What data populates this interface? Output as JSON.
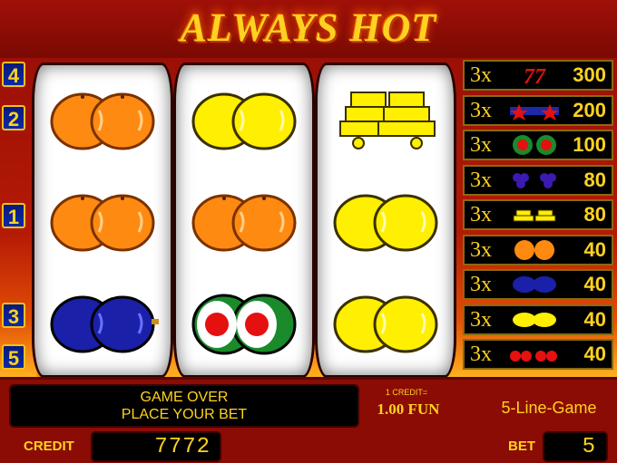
{
  "game": {
    "title": "ALWAYS HOT"
  },
  "reels": [
    [
      "orange",
      "orange",
      "plum"
    ],
    [
      "lemon",
      "orange",
      "melon"
    ],
    [
      "bar",
      "lemon",
      "lemon"
    ]
  ],
  "line_markers": {
    "left": [
      "4",
      "2",
      "1",
      "3",
      "5"
    ]
  },
  "paytable": [
    {
      "multiplier": "3x",
      "symbol": "seven",
      "label": "77",
      "value": "300"
    },
    {
      "multiplier": "3x",
      "symbol": "stars",
      "value": "200"
    },
    {
      "multiplier": "3x",
      "symbol": "melon",
      "value": "100"
    },
    {
      "multiplier": "3x",
      "symbol": "grapes",
      "value": "80"
    },
    {
      "multiplier": "3x",
      "symbol": "bar",
      "value": "80"
    },
    {
      "multiplier": "3x",
      "symbol": "orange",
      "value": "40"
    },
    {
      "multiplier": "3x",
      "symbol": "plum",
      "value": "40"
    },
    {
      "multiplier": "3x",
      "symbol": "lemon",
      "value": "40"
    },
    {
      "multiplier": "3x",
      "symbol": "cherry",
      "value": "40"
    }
  ],
  "status": {
    "line1": "GAME OVER",
    "line2": "PLACE YOUR BET"
  },
  "denomination": {
    "label": "1 CREDIT=",
    "value": "1.00 FUN"
  },
  "game_mode": "5-Line-Game",
  "credit": {
    "label": "CREDIT",
    "value": "7772"
  },
  "bet": {
    "label": "BET",
    "value": "5"
  },
  "colors": {
    "accent": "#ffd21f",
    "panel": "#8a0c05",
    "line_marker": "#0b2aa8"
  }
}
